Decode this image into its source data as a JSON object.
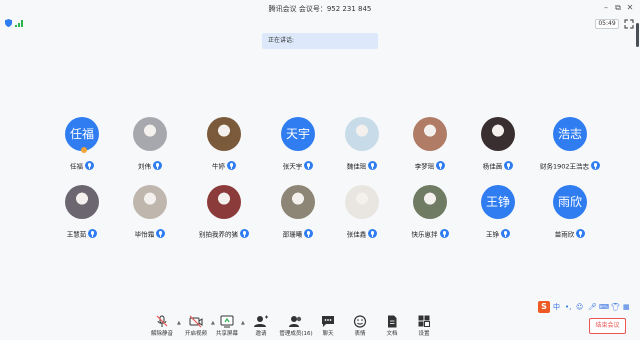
{
  "window": {
    "title": "腾讯会议 会议号：952 231 845"
  },
  "status": {
    "timer": "05:49",
    "speaking_label": "正在讲话:"
  },
  "participants": [
    {
      "name": "任福",
      "avatar_text": "任福",
      "type": "text",
      "hand": true
    },
    {
      "name": "刘伟",
      "avatar_text": "",
      "type": "img",
      "bg": "#a7a8ad"
    },
    {
      "name": "牛婷",
      "avatar_text": "",
      "type": "img",
      "bg": "#7a5a3a"
    },
    {
      "name": "张天宇",
      "avatar_text": "天宇",
      "type": "text"
    },
    {
      "name": "魏佳瑶",
      "avatar_text": "",
      "type": "img",
      "bg": "#c7dbe8"
    },
    {
      "name": "李梦瑶",
      "avatar_text": "",
      "type": "img",
      "bg": "#b07c66"
    },
    {
      "name": "杨佳茜",
      "avatar_text": "",
      "type": "img",
      "bg": "#3a2f30"
    },
    {
      "name": "财务1902王浩志",
      "avatar_text": "浩志",
      "type": "text"
    },
    {
      "name": "王慧茹",
      "avatar_text": "",
      "type": "img",
      "bg": "#6b6670"
    },
    {
      "name": "毕怡霜",
      "avatar_text": "",
      "type": "img",
      "bg": "#bfb7ae"
    },
    {
      "name": "别拍我养的猪",
      "avatar_text": "",
      "type": "img",
      "bg": "#8c3b3b"
    },
    {
      "name": "邵珊曦",
      "avatar_text": "",
      "type": "img",
      "bg": "#8d8575"
    },
    {
      "name": "张佳鑫",
      "avatar_text": "",
      "type": "img",
      "bg": "#e9e6e1"
    },
    {
      "name": "快乐崽拌",
      "avatar_text": "",
      "type": "img",
      "bg": "#6f7c63"
    },
    {
      "name": "王铮",
      "avatar_text": "王铮",
      "type": "text"
    },
    {
      "name": "苗雨欣",
      "avatar_text": "雨欣",
      "type": "text"
    }
  ],
  "toolbar": {
    "mute": "解除静音",
    "video": "开启视频",
    "share": "共享屏幕",
    "invite": "邀请",
    "members": "管理成员(16)",
    "chat": "聊天",
    "reactions": "表情",
    "docs": "文档",
    "settings": "设置"
  },
  "ime": {
    "logo": "S",
    "lang": "中"
  },
  "end_meeting": "结束会议",
  "colors": {
    "accent": "#2f7df0",
    "danger": "#e55555"
  }
}
